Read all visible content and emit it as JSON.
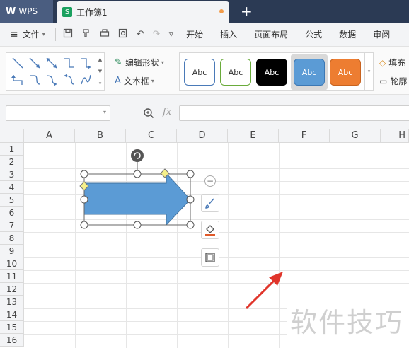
{
  "titlebar": {
    "app_name": "WPS",
    "doc_title": "工作簿1",
    "doc_icon": "S",
    "new_tab": "+"
  },
  "menubar": {
    "file_label": "文件",
    "items": [
      "开始",
      "插入",
      "页面布局",
      "公式",
      "数据",
      "审阅"
    ]
  },
  "ribbon": {
    "edit_shape": "编辑形状",
    "text_box": "文本框",
    "style_label": "Abc",
    "styles": [
      {
        "bg": "#ffffff",
        "border": "#4a7ab8",
        "color": "#333333"
      },
      {
        "bg": "#ffffff",
        "border": "#6aab3b",
        "color": "#333333"
      },
      {
        "bg": "#000000",
        "border": "#000000",
        "color": "#ffffff"
      },
      {
        "bg": "#5b9bd5",
        "border": "#3c78b4",
        "color": "#ffffff"
      },
      {
        "bg": "#ed7d31",
        "border": "#c8631f",
        "color": "#ffffff"
      }
    ],
    "fill_label": "填充",
    "outline_label": "轮廓"
  },
  "formulabar": {
    "fx_label": "fx"
  },
  "grid": {
    "columns": [
      "A",
      "B",
      "C",
      "D",
      "E",
      "F",
      "G",
      "H"
    ],
    "rows": [
      "1",
      "2",
      "3",
      "4",
      "5",
      "6",
      "7",
      "8",
      "9",
      "10",
      "11",
      "12",
      "13",
      "14",
      "15",
      "16"
    ]
  },
  "shape": {
    "fill_color": "#5b9bd5",
    "stroke_color": "#41719c"
  },
  "watermark": "软件技巧"
}
